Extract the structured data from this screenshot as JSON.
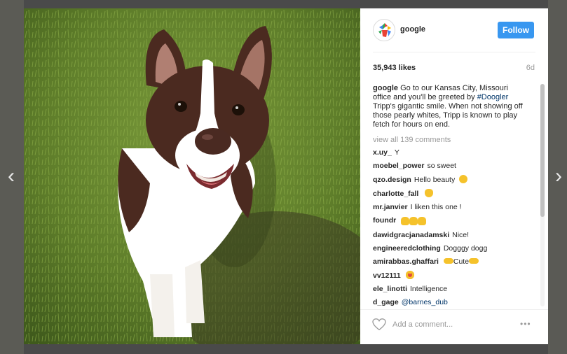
{
  "post": {
    "username": "google",
    "follow_label": "Follow",
    "likes": "35,943 likes",
    "age": "6d",
    "caption_user": "google",
    "caption_part1": "Go to our Kansas City, Missouri office and you'll be greeted by",
    "caption_hashtag": "#Doogler",
    "caption_part2": "Tripp's gigantic smile. When not showing off those pearly whites, Tripp is known to play fetch for hours on end.",
    "view_all": "view all 139 comments",
    "comments": [
      {
        "user": "x.uy_",
        "text": "Y"
      },
      {
        "user": "moebel_power",
        "text": "so sweet"
      },
      {
        "user": "qzo.design",
        "text": "Hello beauty",
        "emoji": "grin-emoji"
      },
      {
        "user": "charlotte_fall",
        "text": "",
        "emoji": "ok-hand-emoji"
      },
      {
        "user": "mr.janvier",
        "text": "I liken this one !"
      },
      {
        "user": "foundr",
        "text": "",
        "emoji": "clapping-hands-emoji"
      },
      {
        "user": "dawidgracjanadamski",
        "text": "Nice!"
      },
      {
        "user": "engineeredclothing",
        "text": "Dogggy dogg"
      },
      {
        "user": "amirabbas.ghaffari",
        "text": "Cute",
        "emoji": "pointing-hands-emoji"
      },
      {
        "user": "vv12111",
        "text": "",
        "emoji": "heart-eyes-emoji"
      },
      {
        "user": "ele_linotti",
        "text": "Intelligence"
      }
    ],
    "cut_comment_user": "d_gage",
    "cut_comment_mention": "@barnes_dub",
    "comment_placeholder": "Add a comment...",
    "more_glyph": "•••"
  },
  "nav": {
    "prev_glyph": "‹",
    "next_glyph": "›"
  },
  "colors": {
    "follow_blue": "#3897f0",
    "hashtag_blue": "#003569",
    "muted_text": "#999999",
    "overlay": "#4a4a4a"
  }
}
